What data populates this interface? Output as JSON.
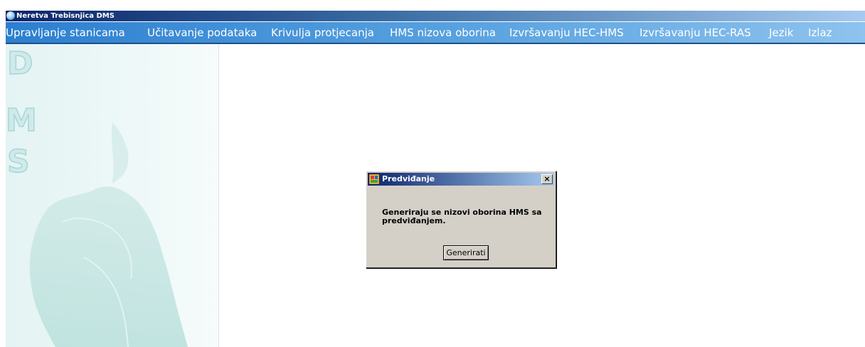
{
  "window": {
    "title": "Neretva Trebisnjica DMS",
    "icon": "app-drop-icon"
  },
  "menubar": {
    "items": [
      "Upravljanje stanicama",
      "Učitavanje podataka",
      "Krivulja protjecanja",
      "HMS nizova oborina",
      "Izvršavanju HEC-HMS",
      "Izvršavanju HEC-RAS",
      "Jezik",
      "Izlaz"
    ]
  },
  "sidebar": {
    "letters": [
      "D",
      "M",
      "S"
    ],
    "image": "map-watermark"
  },
  "dialog": {
    "title": "Predviđanje",
    "close": "×",
    "message": "Generiraju se nizovi oborina HMS sa predviđanjem.",
    "button": "Generirati"
  },
  "colors": {
    "titlebar": "#0a246a",
    "menubar": "#4a98da",
    "dialog_bg": "#d4d0c8",
    "sidebar": "#e8f5f5"
  }
}
